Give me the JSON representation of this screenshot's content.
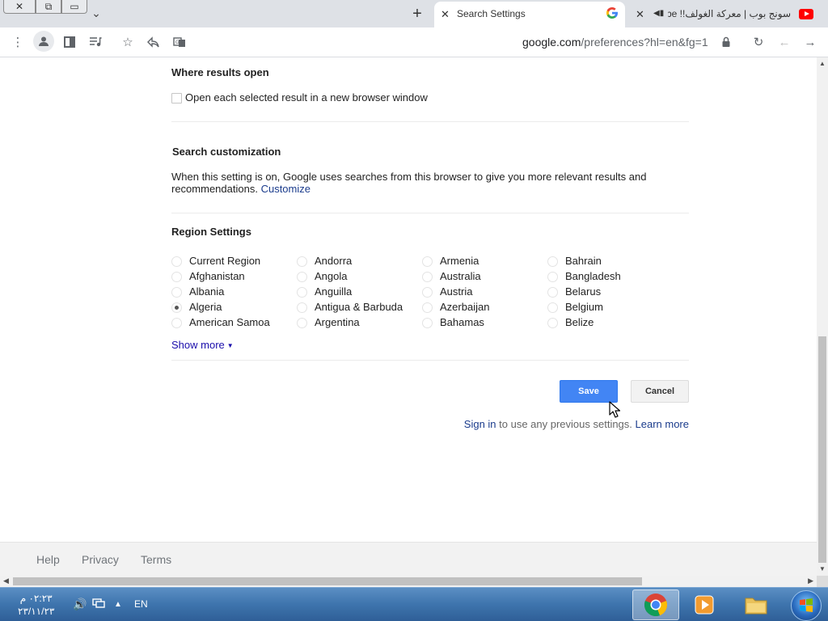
{
  "browser": {
    "tabs": [
      {
        "title": "Search Settings",
        "active": true,
        "favicon": "google-g-icon"
      },
      {
        "title": "سونج بوب | معركة الغولف!! YouTube",
        "active": false,
        "favicon": "youtube-icon"
      }
    ],
    "url_host": "google.com",
    "url_path": "/preferences?hl=en&fg=1"
  },
  "results": {
    "title": "Where results open",
    "checkbox_label": "Open each selected result in a new browser window",
    "checked": false
  },
  "customization": {
    "title": "Search customization",
    "text": "When this setting is on, Google uses searches from this browser to give you more relevant results and recommendations.",
    "link": "Customize"
  },
  "region": {
    "title": "Region Settings",
    "selected": "Algeria",
    "columns": [
      [
        "Current Region",
        "Afghanistan",
        "Albania",
        "Algeria",
        "American Samoa"
      ],
      [
        "Andorra",
        "Angola",
        "Anguilla",
        "Antigua & Barbuda",
        "Argentina"
      ],
      [
        "Armenia",
        "Australia",
        "Austria",
        "Azerbaijan",
        "Bahamas"
      ],
      [
        "Bahrain",
        "Bangladesh",
        "Belarus",
        "Belgium",
        "Belize"
      ]
    ],
    "show_more": "Show more"
  },
  "actions": {
    "save": "Save",
    "cancel": "Cancel",
    "signin_link": "Sign in",
    "signin_text": " to use any previous settings. ",
    "learn_more": "Learn more"
  },
  "footer": {
    "links": [
      "Help",
      "Privacy",
      "Terms"
    ]
  },
  "taskbar": {
    "time": "٠٢:٢٣ م",
    "date": "٢٣/١١/٢٣",
    "lang": "EN"
  },
  "colors": {
    "save_button": "#4285f4",
    "link": "#1a0dab",
    "taskbar": "#3e74ad"
  }
}
